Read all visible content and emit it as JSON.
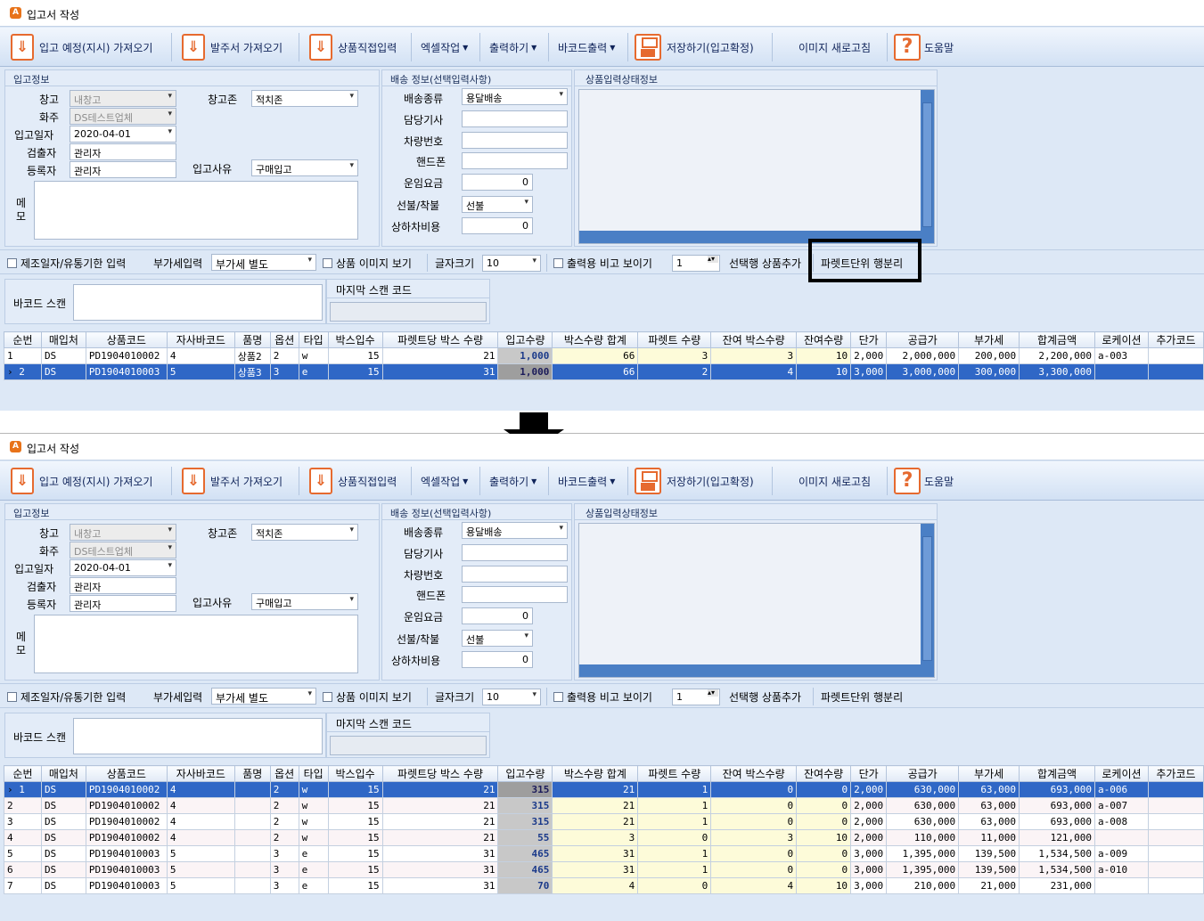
{
  "window": {
    "title": "입고서 작성",
    "icon": "app-logo-icon"
  },
  "toolbar": {
    "btn_import_planned": "입고 예정(지시) 가져오기",
    "btn_import_order": "발주서 가져오기",
    "btn_direct_input": "상품직접입력",
    "btn_excel": "엑셀작업",
    "btn_print": "출력하기",
    "btn_barcode_print": "바코드출력",
    "btn_save": "저장하기(입고확정)",
    "btn_refresh_image": "이미지 새로고침",
    "btn_help": "도움말"
  },
  "receipt_info": {
    "group_label": "입고정보",
    "warehouse_label": "창고",
    "warehouse_value": "내창고",
    "owner_label": "화주",
    "owner_value": "DS테스트업체",
    "date_label": "입고일자",
    "date_value": "2020-04-01",
    "inspector_label": "검출자",
    "inspector_value": "관리자",
    "registrant_label": "등록자",
    "registrant_value": "관리자",
    "zone_label": "창고존",
    "zone_value": "적치존",
    "reason_label": "입고사유",
    "reason_value": "구매입고",
    "memo_label": "메모"
  },
  "delivery_info": {
    "group_label": "배송 정보(선택입력사항)",
    "type_label": "배송종류",
    "type_value": "용달배송",
    "driver_label": "담당기사",
    "driver_value": "",
    "vehicle_label": "차량번호",
    "vehicle_value": "",
    "phone_label": "핸드폰",
    "phone_value": "",
    "fee_label": "운임요금",
    "fee_value": "0",
    "prepay_label": "선불/착불",
    "prepay_value": "선불",
    "handling_label": "상하차비용",
    "handling_value": "0"
  },
  "product_status": {
    "group_label": "상품입력상태정보"
  },
  "options": {
    "mfg_date_label": "제조일자/유통기한 입력",
    "vat_label": "부가세입력",
    "vat_value": "부가세 별도",
    "image_label": "상품 이미지 보기",
    "font_size_label": "글자크기",
    "font_size_value": "10",
    "compare_label": "출력용 비고 보이기",
    "spin_value": "1",
    "add_selected_label": "선택행 상품추가",
    "split_pallet_label": "파렛트단위 행분리"
  },
  "barcode": {
    "scan_label": "바코드 스캔",
    "last_scan_label": "마지막 스캔 코드"
  },
  "grid": {
    "columns": [
      "순번",
      "매입처",
      "상품코드",
      "자사바코드",
      "품명",
      "옵션",
      "타입",
      "박스입수",
      "파렛트당 박스 수량",
      "입고수량",
      "박스수량 합계",
      "파렛트 수량",
      "잔여 박스수량",
      "잔여수량",
      "단가",
      "공급가",
      "부가세",
      "합계금액",
      "로케이션",
      "추가코드"
    ]
  },
  "before_rows": [
    [
      "1",
      "DS",
      "PD1904010002",
      "4",
      "상품2",
      "2",
      "w",
      "15",
      "21",
      "1,000",
      "66",
      "3",
      "3",
      "10",
      "2,000",
      "2,000,000",
      "200,000",
      "2,200,000",
      "a-003",
      ""
    ],
    [
      "2",
      "DS",
      "PD1904010003",
      "5",
      "상품3",
      "3",
      "e",
      "15",
      "31",
      "1,000",
      "66",
      "2",
      "4",
      "10",
      "3,000",
      "3,000,000",
      "300,000",
      "3,300,000",
      "",
      ""
    ]
  ],
  "after_rows": [
    [
      "1",
      "DS",
      "PD1904010002",
      "4",
      "",
      "2",
      "w",
      "15",
      "21",
      "315",
      "21",
      "1",
      "0",
      "0",
      "2,000",
      "630,000",
      "63,000",
      "693,000",
      "a-006",
      ""
    ],
    [
      "2",
      "DS",
      "PD1904010002",
      "4",
      "",
      "2",
      "w",
      "15",
      "21",
      "315",
      "21",
      "1",
      "0",
      "0",
      "2,000",
      "630,000",
      "63,000",
      "693,000",
      "a-007",
      ""
    ],
    [
      "3",
      "DS",
      "PD1904010002",
      "4",
      "",
      "2",
      "w",
      "15",
      "21",
      "315",
      "21",
      "1",
      "0",
      "0",
      "2,000",
      "630,000",
      "63,000",
      "693,000",
      "a-008",
      ""
    ],
    [
      "4",
      "DS",
      "PD1904010002",
      "4",
      "",
      "2",
      "w",
      "15",
      "21",
      "55",
      "3",
      "0",
      "3",
      "10",
      "2,000",
      "110,000",
      "11,000",
      "121,000",
      "",
      ""
    ],
    [
      "5",
      "DS",
      "PD1904010003",
      "5",
      "",
      "3",
      "e",
      "15",
      "31",
      "465",
      "31",
      "1",
      "0",
      "0",
      "3,000",
      "1,395,000",
      "139,500",
      "1,534,500",
      "a-009",
      ""
    ],
    [
      "6",
      "DS",
      "PD1904010003",
      "5",
      "",
      "3",
      "e",
      "15",
      "31",
      "465",
      "31",
      "1",
      "0",
      "0",
      "3,000",
      "1,395,000",
      "139,500",
      "1,534,500",
      "a-010",
      ""
    ],
    [
      "7",
      "DS",
      "PD1904010003",
      "5",
      "",
      "3",
      "e",
      "15",
      "31",
      "70",
      "4",
      "0",
      "4",
      "10",
      "3,000",
      "210,000",
      "21,000",
      "231,000",
      "",
      ""
    ]
  ],
  "selected": {
    "before": 1,
    "after": 0
  },
  "transition_icon": "down-arrow-icon"
}
